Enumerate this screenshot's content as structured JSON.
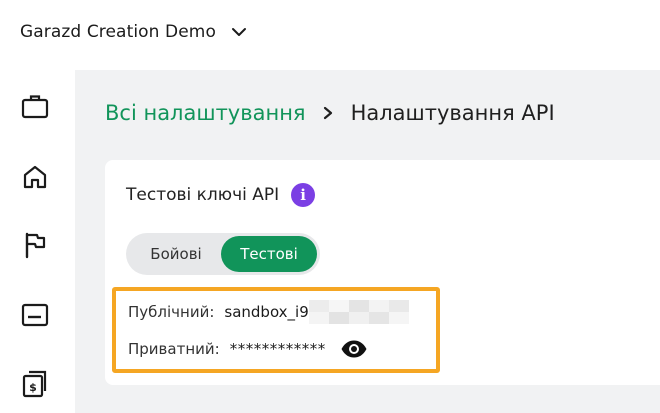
{
  "header": {
    "workspace_name": "Garazd Creation Demo",
    "dropdown_icon": "chevron-down-icon"
  },
  "sidebar": {
    "items": [
      {
        "icon": "briefcase-icon"
      },
      {
        "icon": "home-icon"
      },
      {
        "icon": "flag-icon"
      },
      {
        "icon": "card-icon"
      },
      {
        "icon": "payments-icon"
      }
    ]
  },
  "breadcrumb": {
    "parent": "Всі налаштування",
    "separator_icon": "chevron-right-icon",
    "current": "Налаштування API"
  },
  "api_card": {
    "title": "Тестові ключі API",
    "info_icon": "info-icon",
    "info_glyph": "i",
    "toggle": {
      "live_label": "Бойові",
      "test_label": "Тестові",
      "selected": "Тестові"
    },
    "public_key": {
      "label": "Публічний:",
      "value": "sandbox_i9"
    },
    "private_key": {
      "label": "Приватний:",
      "value": "************",
      "reveal_icon": "eye-icon"
    }
  },
  "colors": {
    "accent_green": "#11945a",
    "info_purple": "#7b3fe4",
    "highlight_orange": "#f5a623",
    "main_bg": "#f1f2f3"
  }
}
